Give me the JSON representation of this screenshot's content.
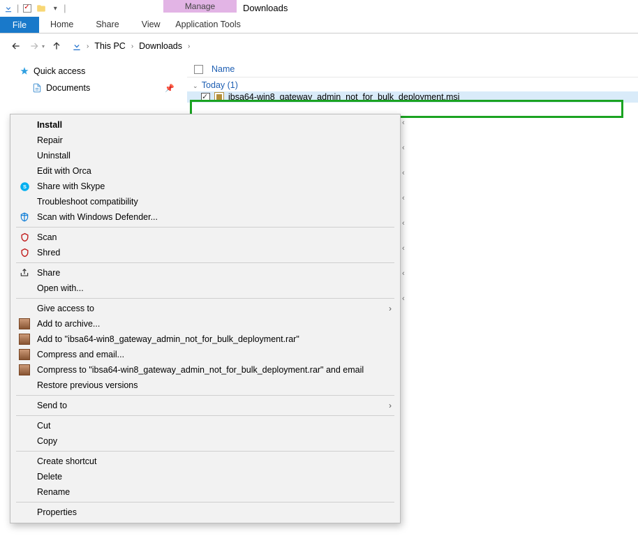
{
  "titlebar": {
    "folder_name": "Downloads"
  },
  "manage": {
    "label": "Manage",
    "sublabel": "Application Tools"
  },
  "ribbon": {
    "file": "File",
    "home": "Home",
    "share": "Share",
    "view": "View"
  },
  "breadcrumb": {
    "root": "This PC",
    "current": "Downloads"
  },
  "sidebar": {
    "quick": "Quick access",
    "documents": "Documents"
  },
  "columns": {
    "name": "Name"
  },
  "group": {
    "label": "Today (1)"
  },
  "file": {
    "name": "ibsa64-win8_gateway_admin_not_for_bulk_deployment.msi"
  },
  "context": {
    "install": "Install",
    "repair": "Repair",
    "uninstall": "Uninstall",
    "orca": "Edit with Orca",
    "skype": "Share with Skype",
    "troubleshoot": "Troubleshoot compatibility",
    "defender": "Scan with Windows Defender...",
    "scan": "Scan",
    "shred": "Shred",
    "share": "Share",
    "openwith": "Open with...",
    "giveaccess": "Give access to",
    "addarchive": "Add to archive...",
    "addrar": "Add to \"ibsa64-win8_gateway_admin_not_for_bulk_deployment.rar\"",
    "compressmail": "Compress and email...",
    "compressrarmail": "Compress to \"ibsa64-win8_gateway_admin_not_for_bulk_deployment.rar\" and email",
    "restore": "Restore previous versions",
    "sendto": "Send to",
    "cut": "Cut",
    "copy": "Copy",
    "shortcut": "Create shortcut",
    "delete": "Delete",
    "rename": "Rename",
    "properties": "Properties"
  }
}
